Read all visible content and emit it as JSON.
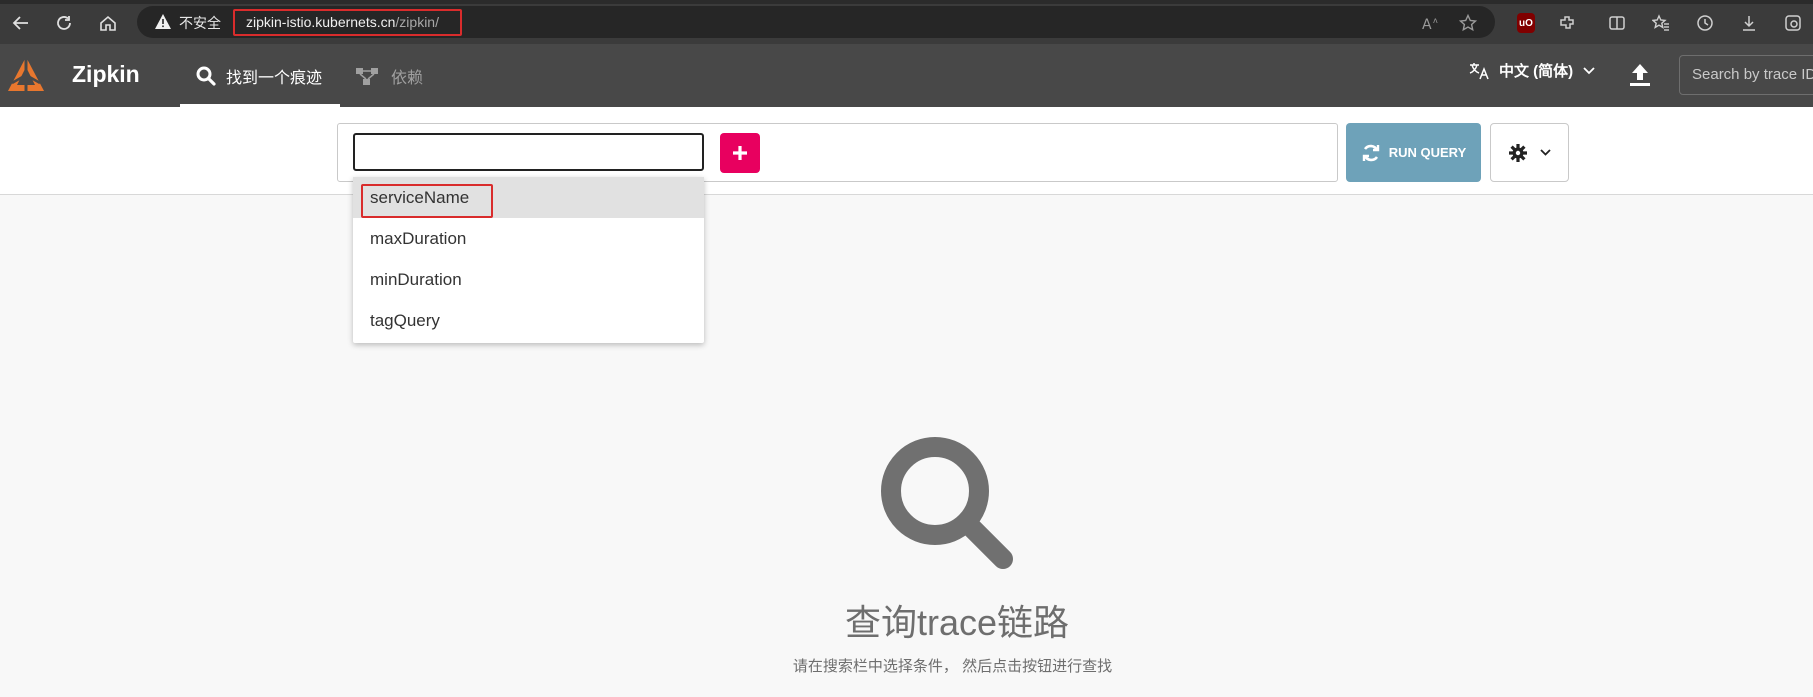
{
  "browser": {
    "insecure_label": "不安全",
    "url_host": "zipkin-istio.kubernets.cn",
    "url_path": "/zipkin/",
    "icons": [
      "back-icon",
      "reload-icon",
      "home-icon",
      "read-aloud-icon",
      "favorite-star-icon",
      "ublock-icon",
      "extensions-icon",
      "split-screen-icon",
      "favorites-icon",
      "history-icon",
      "download-icon",
      "browser-essentials-icon"
    ],
    "ublock_label": "uO"
  },
  "header": {
    "brand": "Zipkin",
    "tabs": [
      {
        "label": "找到一个痕迹",
        "icon": "search-icon",
        "active": true
      },
      {
        "label": "依赖",
        "icon": "dependencies-icon",
        "active": false
      }
    ],
    "language": "中文 (简体)",
    "trace_search_placeholder": "Search by trace ID"
  },
  "query": {
    "input_value": "",
    "add_icon": "plus-icon",
    "run_label": "RUN QUERY",
    "run_icon": "refresh-icon",
    "settings_icon": "gear-icon",
    "dropdown_options": [
      "serviceName",
      "maxDuration",
      "minDuration",
      "tagQuery"
    ]
  },
  "empty_state": {
    "icon": "search-icon",
    "title": "查询trace链路",
    "subtitle": "请在搜索栏中选择条件， 然后点击按钮进行查找"
  },
  "colors": {
    "header_bg": "#484848",
    "accent_pink": "#e8005f",
    "run_button": "#6ea2b9",
    "highlight_red": "#d92c2c"
  }
}
